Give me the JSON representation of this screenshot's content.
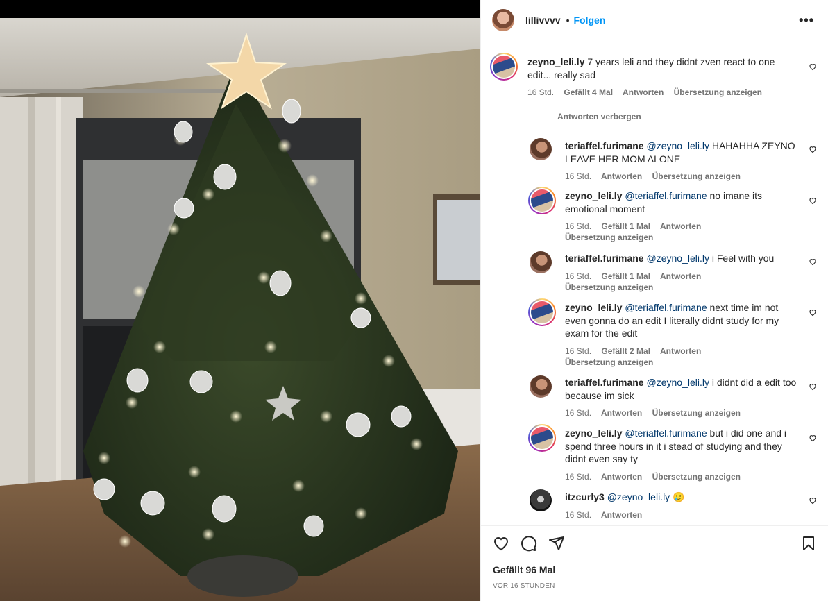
{
  "post": {
    "owner": "lillivvvv",
    "separator": "•",
    "follow_label": "Folgen",
    "more_label": "•••",
    "likes": "Gefällt 96 Mal",
    "posted": "VOR 16 STUNDEN"
  },
  "hide_replies_label": "Antworten verbergen",
  "comments": [
    {
      "user": "zeyno_leli.ly",
      "mention": "",
      "text": "7 years leli and they didnt zven react to one edit... really sad",
      "time": "16 Std.",
      "likes": "Gefällt 4 Mal",
      "reply": "Antworten",
      "translate": "Übersetzung anzeigen"
    },
    {
      "user": "teriaffel.furimane",
      "mention": "@zeyno_leli.ly",
      "text": "HAHAHHA ZEYNO LEAVE HER MOM ALONE",
      "time": "16 Std.",
      "likes": "",
      "reply": "Antworten",
      "translate": "Übersetzung anzeigen"
    },
    {
      "user": "zeyno_leli.ly",
      "mention": "@teriaffel.furimane",
      "text": "no imane its emotional moment",
      "time": "16 Std.",
      "likes": "Gefällt 1 Mal",
      "reply": "Antworten",
      "translate": "Übersetzung anzeigen"
    },
    {
      "user": "teriaffel.furimane",
      "mention": "@zeyno_leli.ly",
      "text": "i Feel with you",
      "time": "16 Std.",
      "likes": "Gefällt 1 Mal",
      "reply": "Antworten",
      "translate": "Übersetzung anzeigen"
    },
    {
      "user": "zeyno_leli.ly",
      "mention": "@teriaffel.furimane",
      "text": "next time im not even gonna do an edit I literally didnt study for my exam for the edit",
      "time": "16 Std.",
      "likes": "Gefällt 2 Mal",
      "reply": "Antworten",
      "translate": "Übersetzung anzeigen"
    },
    {
      "user": "teriaffel.furimane",
      "mention": "@zeyno_leli.ly",
      "text": "i didnt did a edit too because im sick",
      "time": "16 Std.",
      "likes": "",
      "reply": "Antworten",
      "translate": "Übersetzung anzeigen"
    },
    {
      "user": "zeyno_leli.ly",
      "mention": "@teriaffel.furimane",
      "text": "but i did one and i spend three hours in it i stead of studying and they didnt even say ty",
      "time": "16 Std.",
      "likes": "",
      "reply": "Antworten",
      "translate": "Übersetzung anzeigen"
    },
    {
      "user": "itzcurly3",
      "mention": "@zeyno_leli.ly",
      "text": "🥲",
      "time": "16 Std.",
      "likes": "",
      "reply": "Antworten",
      "translate": ""
    }
  ],
  "icons": {
    "like": "heart-icon",
    "comment": "comment-icon",
    "share": "share-icon",
    "save": "bookmark-icon"
  },
  "colors": {
    "accent": "#0095f6",
    "mention": "#00376b",
    "secondary_text": "#737373"
  }
}
